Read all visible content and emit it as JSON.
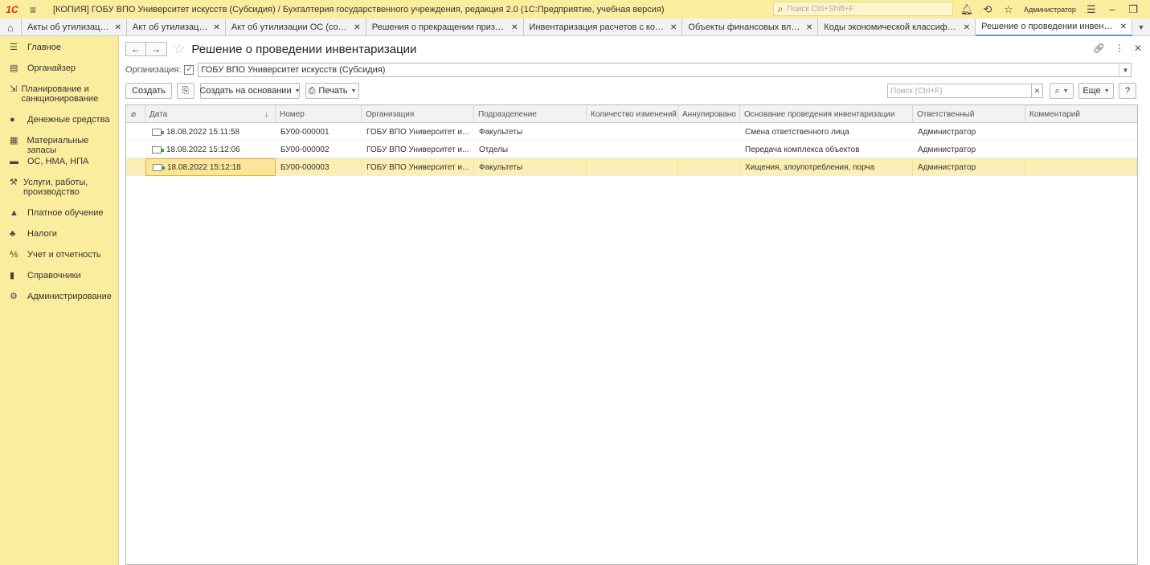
{
  "app": {
    "logo": "1С",
    "title": "[КОПИЯ] ГОБУ ВПО Университет искусств (Субсидия) / Бухгалтерия государственного учреждения, редакция 2.0  (1С:Предприятие, учебная версия)",
    "search_placeholder": "Поиск Ctrl+Shift+F",
    "user": "Администратор"
  },
  "tabs": [
    {
      "label": "Акты об утилизации МЗ"
    },
    {
      "label": "Акт об утилизации ОС"
    },
    {
      "label": "Акт об утилизации ОС (создание)"
    },
    {
      "label": "Решения о прекращении признания..."
    },
    {
      "label": "Инвентаризация расчетов с контраг..."
    },
    {
      "label": "Объекты финансовых вложений"
    },
    {
      "label": "Коды экономической классификаци..."
    },
    {
      "label": "Решение о проведении инвентариз..."
    }
  ],
  "sidebar": {
    "items": [
      {
        "label": "Главное",
        "icon": "menu-icon"
      },
      {
        "label": "Органайзер",
        "icon": "organizer-icon"
      },
      {
        "label": "Планирование и санкционирование",
        "icon": "planning-icon"
      },
      {
        "label": "Денежные средства",
        "icon": "money-icon"
      },
      {
        "label": "Материальные запасы",
        "icon": "stock-icon"
      },
      {
        "label": "ОС, НМА, НПА",
        "icon": "truck-icon"
      },
      {
        "label": "Услуги, работы, производство",
        "icon": "tools-icon"
      },
      {
        "label": "Платное обучение",
        "icon": "graduation-icon"
      },
      {
        "label": "Налоги",
        "icon": "taxes-icon"
      },
      {
        "label": "Учет и отчетность",
        "icon": "reports-icon"
      },
      {
        "label": "Справочники",
        "icon": "books-icon"
      },
      {
        "label": "Администрирование",
        "icon": "gear-icon"
      }
    ]
  },
  "form": {
    "title": "Решение о проведении инвентаризации",
    "org_label": "Организация:",
    "org_value": "ГОБУ ВПО Университет искусств (Субсидия)",
    "org_checked": true
  },
  "toolbar": {
    "create": "Создать",
    "create_based": "Создать на основании",
    "print": "Печать",
    "search_placeholder": "Поиск (Ctrl+F)",
    "more": "Еще",
    "help": "?"
  },
  "table": {
    "columns": [
      "Дата",
      "Номер",
      "Организация",
      "Подразделение",
      "Количество изменений",
      "Аннулировано",
      "Основание проведения инвентаризации",
      "Ответственный",
      "Комментарий"
    ],
    "rows": [
      {
        "date": "18.08.2022 15:11:58",
        "number": "БУ00-000001",
        "org": "ГОБУ ВПО Университет и...",
        "dept": "Факультеты",
        "changes": "",
        "annulled": "",
        "basis": "Смена ответственного лица",
        "responsible": "Администратор",
        "comment": ""
      },
      {
        "date": "18.08.2022 15:12:06",
        "number": "БУ00-000002",
        "org": "ГОБУ ВПО Университет и...",
        "dept": "Отделы",
        "changes": "",
        "annulled": "",
        "basis": "Передача комплекса объектов",
        "responsible": "Администратор",
        "comment": ""
      },
      {
        "date": "18.08.2022 15:12:18",
        "number": "БУ00-000003",
        "org": "ГОБУ ВПО Университет и...",
        "dept": "Факультеты",
        "changes": "",
        "annulled": "",
        "basis": "Хищения, злоупотребления, порча",
        "responsible": "Администратор",
        "comment": "",
        "selected": true
      }
    ]
  },
  "colors": {
    "accent_yellow": "#fbed9e",
    "selection": "#fcefb4",
    "logo_red": "#d6281c"
  }
}
